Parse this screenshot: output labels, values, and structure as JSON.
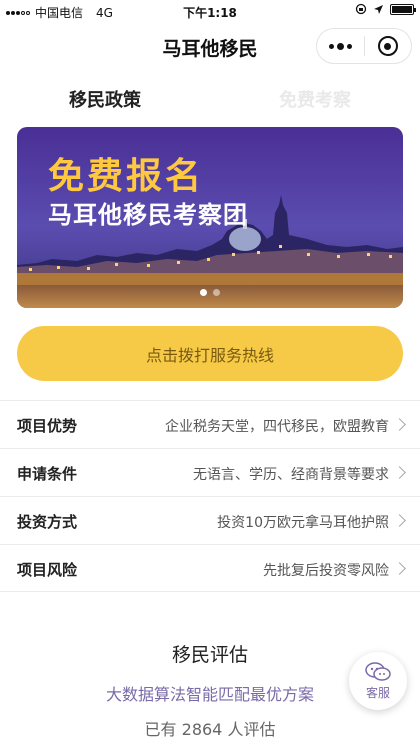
{
  "status_bar": {
    "carrier": "中国电信",
    "network": "4G",
    "time": "下午1:18"
  },
  "nav": {
    "title": "马耳他移民",
    "more_icon": "more-dots-icon",
    "close_icon": "target-circle-icon"
  },
  "tabs": [
    {
      "label": "移民政策",
      "active": true
    },
    {
      "label": "免费考察",
      "active": false
    }
  ],
  "banner": {
    "title": "免费报名",
    "subtitle": "马耳他移民考察团",
    "accent_color": "#ffc93f"
  },
  "hotline": {
    "label": "点击拨打服务热线",
    "color": "#f6ca46"
  },
  "info_rows": [
    {
      "label": "项目优势",
      "value": "企业税务天堂，四代移民，欧盟教育"
    },
    {
      "label": "申请条件",
      "value": "无语言、学历、经商背景等要求"
    },
    {
      "label": "投资方式",
      "value": "投资10万欧元拿马耳他护照"
    },
    {
      "label": "项目风险",
      "value": "先批复后投资零风险"
    }
  ],
  "assessment": {
    "title": "移民评估",
    "subtitle": "大数据算法智能匹配最优方案",
    "count_text": "已有 2864 人评估"
  },
  "customer_service": {
    "label": "客服",
    "icon": "chat-bubbles-icon"
  }
}
